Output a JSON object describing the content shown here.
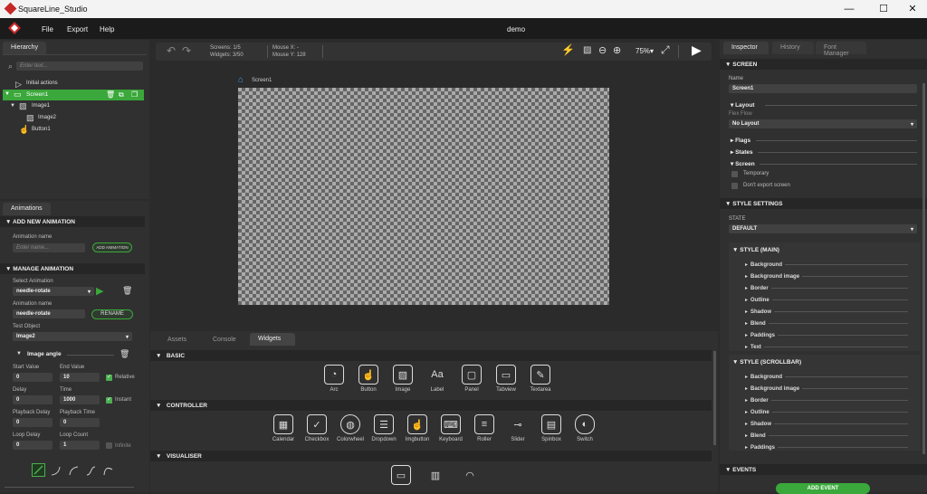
{
  "window": {
    "title": "SquareLine_Studio",
    "minimize": "—",
    "maximize": "☐",
    "close": "✕"
  },
  "menu": {
    "file": "File",
    "export": "Export",
    "help": "Help",
    "project": "demo"
  },
  "hierarchy": {
    "tab": "Hierarchy",
    "search_placeholder": "Enter text...",
    "items": [
      {
        "label": "Initial actions"
      },
      {
        "label": "Screen1"
      },
      {
        "label": "Image1"
      },
      {
        "label": "Image2"
      },
      {
        "label": "Button1"
      }
    ]
  },
  "animations": {
    "tab": "Animations",
    "add_header": "ADD NEW ANIMATION",
    "anim_name_label": "Animation name",
    "anim_name_placeholder": "Enter name...",
    "add_button": "ADD ANIMATION",
    "manage_header": "MANAGE ANIMATION",
    "select_label": "Select Animation",
    "selected": "needle-rotate",
    "name_label": "Animation name",
    "name_value": "needle-rotate",
    "rename": "RENAME",
    "test_object_label": "Test Object",
    "test_object": "Image2",
    "property": "Image angle",
    "start_value_label": "Start Value",
    "start_value": "0",
    "end_value_label": "End Value",
    "end_value": "10",
    "relative": "Relative",
    "delay_label": "Delay",
    "delay": "0",
    "time_label": "Time",
    "time": "1000",
    "instant": "Instant",
    "pb_delay_label": "Playback Delay",
    "pb_delay": "0",
    "pb_time_label": "Playback Time",
    "pb_time": "0",
    "loop_delay_label": "Loop Delay",
    "loop_delay": "0",
    "loop_count_label": "Loop Count",
    "loop_count": "1",
    "infinite": "Infinite"
  },
  "toolbar": {
    "screens": "Screens: 1/5",
    "widgets": "Widgets: 3/50",
    "mouse_x": "Mouse X: -",
    "mouse_y": "Mouse Y:  128",
    "zoom": "75%"
  },
  "canvas": {
    "screen_label": "Screen1"
  },
  "bottom": {
    "tabs": [
      "Assets",
      "Console",
      "Widgets"
    ],
    "sections": [
      {
        "title": "BASIC",
        "items": [
          "Arc",
          "Button",
          "Image",
          "Label",
          "Panel",
          "Tabview",
          "Textarea"
        ],
        "icons": [
          "◔",
          "☝",
          "▨",
          "Aa",
          "▢",
          "▭",
          "✎"
        ]
      },
      {
        "title": "CONTROLLER",
        "items": [
          "Calendar",
          "Checkbox",
          "Colorwheel",
          "Dropdown",
          "Imgbutton",
          "Keyboard",
          "Roller",
          "Slider",
          "Spinbox",
          "Switch"
        ],
        "icons": [
          "▦",
          "✓",
          "◍",
          "☰",
          "☝",
          "⌨",
          "≡",
          "⊸",
          "▤",
          "◐"
        ]
      },
      {
        "title": "VISUALISER",
        "items": [
          "",
          "",
          ""
        ],
        "icons": [
          "▭",
          "▥",
          "◠"
        ]
      }
    ]
  },
  "inspector": {
    "tabs": [
      "Inspector",
      "History",
      "Font Manager"
    ],
    "screen_header": "SCREEN",
    "name_label": "Name",
    "name_value": "Screen1",
    "layout": "Layout",
    "flex_flow": "Flex Flow",
    "layout_value": "No Layout",
    "flags": "Flags",
    "states": "States",
    "screen": "Screen",
    "temporary": "Temporary",
    "dont_export": "Don't export screen",
    "style_header": "STYLE SETTINGS",
    "state_label": "STATE",
    "state_value": "DEFAULT",
    "style_main": "STYLE (MAIN)",
    "main_items": [
      "Background",
      "Background image",
      "Border",
      "Outline",
      "Shadow",
      "Blend",
      "Paddings",
      "Text"
    ],
    "style_scroll": "STYLE (SCROLLBAR)",
    "scroll_items": [
      "Background",
      "Background image",
      "Border",
      "Outline",
      "Shadow",
      "Blend",
      "Paddings"
    ],
    "events_header": "EVENTS",
    "add_event": "ADD EVENT"
  },
  "colors": {
    "accent": "#3aa83a",
    "bg": "#2b2b2b"
  }
}
